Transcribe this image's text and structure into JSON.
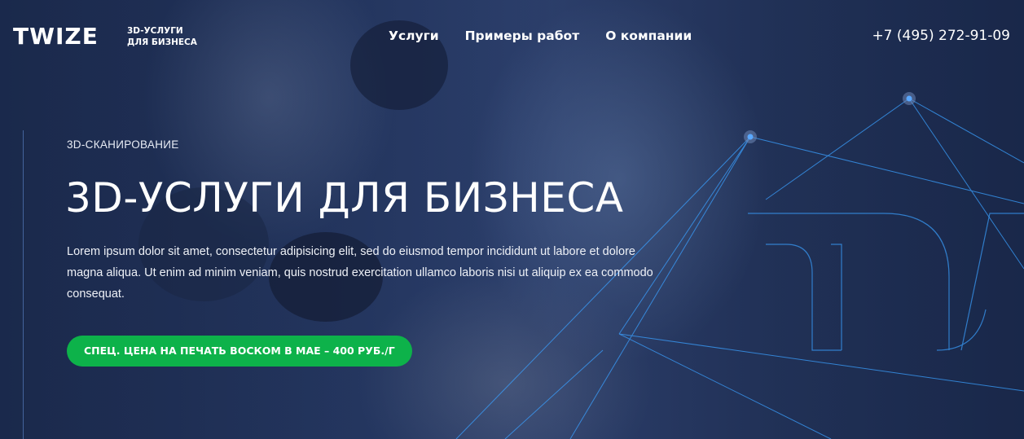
{
  "header": {
    "logo": "TWIZE",
    "tagline_line1": "3D-УСЛУГИ",
    "tagline_line2": "ДЛЯ БИЗНЕСА",
    "nav": [
      {
        "label": "Услуги"
      },
      {
        "label": "Примеры работ"
      },
      {
        "label": "О компании"
      }
    ],
    "phone": "+7 (495) 272-91-09"
  },
  "hero": {
    "eyebrow": "3D-СКАНИРОВАНИЕ",
    "title": "3D-УСЛУГИ ДЛЯ БИЗНЕСА",
    "lead": "Lorem ipsum dolor sit amet, consectetur adipisicing elit, sed do eiusmod tempor incididunt ut labore et dolore magna aliqua. Ut enim ad minim veniam, quis nostrud exercitation ullamco laboris nisi ut aliquip ex ea commodo consequat.",
    "cta": "СПЕЦ. ЦЕНА НА ПЕЧАТЬ ВОСКОМ В МАЕ – 400 РУБ./Г"
  },
  "colors": {
    "accent_green": "#0db24a",
    "line_blue": "#3aa0ff",
    "background_navy": "#1d2b4c"
  }
}
